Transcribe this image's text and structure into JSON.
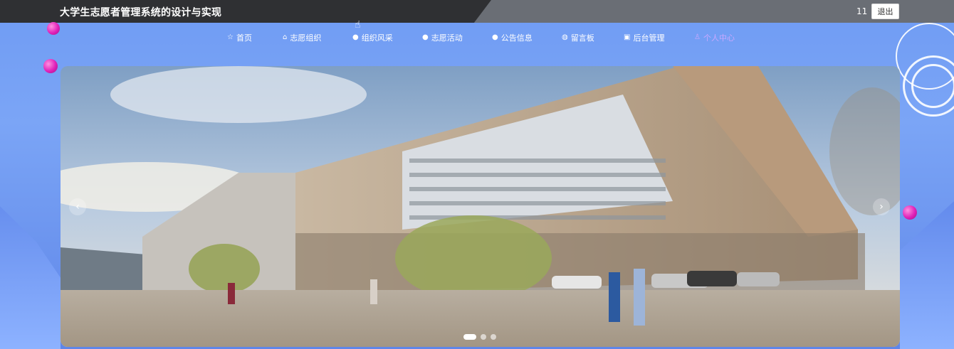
{
  "header": {
    "title": "大学生志愿者管理系统的设计与实现",
    "user_id": "11",
    "logout_label": "退出"
  },
  "nav": {
    "items": [
      {
        "label": "首页",
        "icon": "star-icon"
      },
      {
        "label": "志愿组织",
        "icon": "home-icon"
      },
      {
        "label": "组织风采",
        "icon": "info-icon"
      },
      {
        "label": "志愿活动",
        "icon": "info-icon"
      },
      {
        "label": "公告信息",
        "icon": "info-icon"
      },
      {
        "label": "留言板",
        "icon": "globe-icon"
      },
      {
        "label": "后台管理",
        "icon": "briefcase-icon"
      },
      {
        "label": "个人中心",
        "icon": "user-icon"
      }
    ],
    "active_label": "个人中心"
  },
  "carousel": {
    "image_alt": "",
    "slide_count": 3,
    "active_index": 0
  },
  "colors": {
    "accent": "#7ba5f6",
    "active_nav": "#c9a8ff",
    "topbar": "#2f3033"
  }
}
